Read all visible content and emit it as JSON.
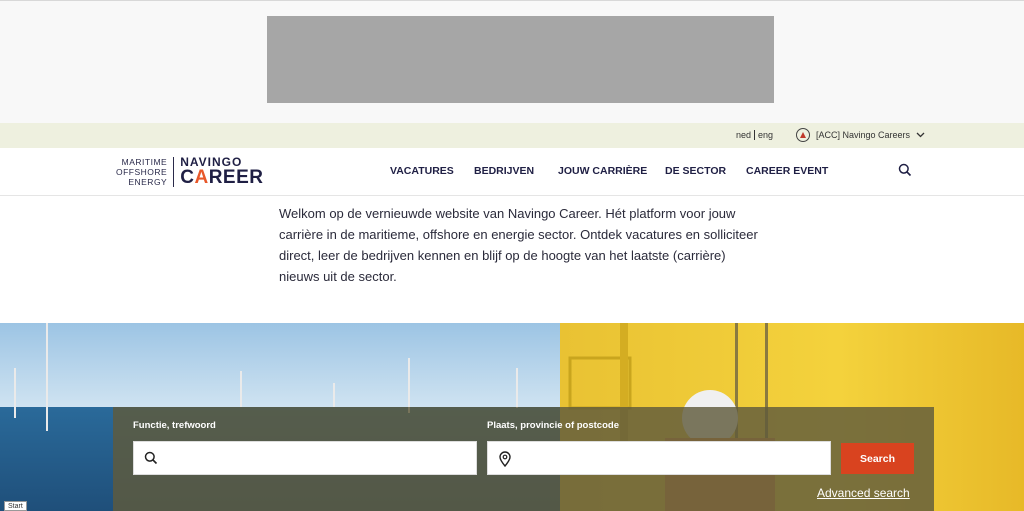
{
  "utility_bar": {
    "lang_ned": "ned",
    "lang_eng": "eng",
    "account_label": "[ACC] Navingo Careers",
    "account_icon": "navingo-logo-icon",
    "chevron_icon": "chevron-down-icon"
  },
  "header": {
    "logo": {
      "line1": "MARITIME",
      "line2": "OFFSHORE",
      "line3": "ENERGY",
      "brand_top": "NAVINGO",
      "brand_bottom_c": "C",
      "brand_bottom_a": "A",
      "brand_bottom_rest": "REER"
    },
    "nav": [
      "VACATURES",
      "BEDRIJVEN",
      "JOUW CARRIÈRE",
      "DE SECTOR",
      "CAREER EVENT"
    ],
    "search_icon": "search-icon"
  },
  "intro": {
    "text": "Welkom op de vernieuwde website van Navingo Career. Hét platform voor jouw carrière in de maritieme, offshore en energie sector. Ontdek vacatures en solliciteer direct, leer de bedrijven kennen en blijf op de hoogte van het laatste (carrière) nieuws uit de sector."
  },
  "job_search": {
    "keyword_label": "Functie, trefwoord",
    "keyword_value": "",
    "location_label": "Plaats, provincie of postcode",
    "location_value": "",
    "search_button": "Search",
    "advanced_link": "Advanced search"
  },
  "badge": {
    "start": "Start"
  },
  "colors": {
    "accent": "#d9431f",
    "brand_navy": "#1f1f44",
    "util_bar_bg": "#eef0df"
  }
}
